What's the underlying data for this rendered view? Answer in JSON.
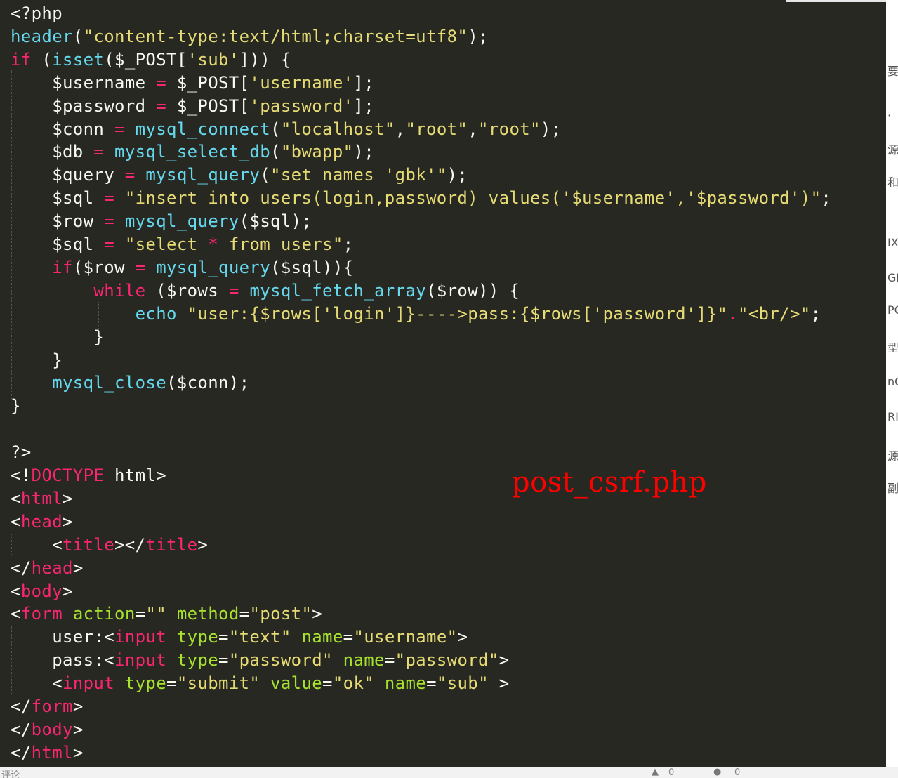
{
  "colors": {
    "background": "#272822",
    "default": "#F8F8F2",
    "keyword": "#F92672",
    "function": "#66D9EF",
    "string": "#E6DB74",
    "attribute": "#A6E22E",
    "annotation": "#FF0000"
  },
  "code_lines": [
    [
      [
        "<?php",
        "d"
      ]
    ],
    [
      [
        "header",
        "f"
      ],
      [
        "(",
        "d"
      ],
      [
        "\"content-type:text/html;charset=utf8\"",
        "s"
      ],
      [
        ");",
        "d"
      ]
    ],
    [
      [
        "if",
        "k"
      ],
      [
        " (",
        "d"
      ],
      [
        "isset",
        "f"
      ],
      [
        "($_POST[",
        "d"
      ],
      [
        "'sub'",
        "s"
      ],
      [
        "])) {",
        "d"
      ]
    ],
    [
      [
        "    $username ",
        "d"
      ],
      [
        "=",
        "k"
      ],
      [
        " $_POST[",
        "d"
      ],
      [
        "'username'",
        "s"
      ],
      [
        "];",
        "d"
      ]
    ],
    [
      [
        "    $password ",
        "d"
      ],
      [
        "=",
        "k"
      ],
      [
        " $_POST[",
        "d"
      ],
      [
        "'password'",
        "s"
      ],
      [
        "];",
        "d"
      ]
    ],
    [
      [
        "    $conn ",
        "d"
      ],
      [
        "=",
        "k"
      ],
      [
        " ",
        "d"
      ],
      [
        "mysql_connect",
        "f"
      ],
      [
        "(",
        "d"
      ],
      [
        "\"localhost\"",
        "s"
      ],
      [
        ",",
        "d"
      ],
      [
        "\"root\"",
        "s"
      ],
      [
        ",",
        "d"
      ],
      [
        "\"root\"",
        "s"
      ],
      [
        ");",
        "d"
      ]
    ],
    [
      [
        "    $db ",
        "d"
      ],
      [
        "=",
        "k"
      ],
      [
        " ",
        "d"
      ],
      [
        "mysql_select_db",
        "f"
      ],
      [
        "(",
        "d"
      ],
      [
        "\"bwapp\"",
        "s"
      ],
      [
        ");",
        "d"
      ]
    ],
    [
      [
        "    $query ",
        "d"
      ],
      [
        "=",
        "k"
      ],
      [
        " ",
        "d"
      ],
      [
        "mysql_query",
        "f"
      ],
      [
        "(",
        "d"
      ],
      [
        "\"set names 'gbk'\"",
        "s"
      ],
      [
        ");",
        "d"
      ]
    ],
    [
      [
        "    $sql ",
        "d"
      ],
      [
        "=",
        "k"
      ],
      [
        " ",
        "d"
      ],
      [
        "\"insert into users(login,password) values('$username','$password')\"",
        "s"
      ],
      [
        ";",
        "d"
      ]
    ],
    [
      [
        "    $row ",
        "d"
      ],
      [
        "=",
        "k"
      ],
      [
        " ",
        "d"
      ],
      [
        "mysql_query",
        "f"
      ],
      [
        "($sql);",
        "d"
      ]
    ],
    [
      [
        "    $sql ",
        "d"
      ],
      [
        "=",
        "k"
      ],
      [
        " ",
        "d"
      ],
      [
        "\"select ",
        "s"
      ],
      [
        "*",
        "k"
      ],
      [
        " from users\"",
        "s"
      ],
      [
        ";",
        "d"
      ]
    ],
    [
      [
        "    ",
        "d"
      ],
      [
        "if",
        "k"
      ],
      [
        "($row ",
        "d"
      ],
      [
        "=",
        "k"
      ],
      [
        " ",
        "d"
      ],
      [
        "mysql_query",
        "f"
      ],
      [
        "($sql)){",
        "d"
      ]
    ],
    [
      [
        "        ",
        "d"
      ],
      [
        "while",
        "k"
      ],
      [
        " ($rows ",
        "d"
      ],
      [
        "=",
        "k"
      ],
      [
        " ",
        "d"
      ],
      [
        "mysql_fetch_array",
        "f"
      ],
      [
        "($row)) {",
        "d"
      ]
    ],
    [
      [
        "            ",
        "d"
      ],
      [
        "echo",
        "f"
      ],
      [
        " ",
        "d"
      ],
      [
        "\"user:{$rows['login']}---->pass:{$rows['password']}\"",
        "s"
      ],
      [
        ".",
        "k"
      ],
      [
        "\"<br/>\"",
        "s"
      ],
      [
        ";",
        "d"
      ]
    ],
    [
      [
        "        }",
        "d"
      ]
    ],
    [
      [
        "    }",
        "d"
      ]
    ],
    [
      [
        "    ",
        "d"
      ],
      [
        "mysql_close",
        "f"
      ],
      [
        "($conn);",
        "d"
      ]
    ],
    [
      [
        "}",
        "d"
      ]
    ],
    [
      [
        "",
        "d"
      ]
    ],
    [
      [
        "?>",
        "d"
      ]
    ],
    [
      [
        "<!",
        "d"
      ],
      [
        "DOCTYPE",
        "k"
      ],
      [
        " html>",
        "d"
      ]
    ],
    [
      [
        "<",
        "d"
      ],
      [
        "html",
        "k"
      ],
      [
        ">",
        "d"
      ]
    ],
    [
      [
        "<",
        "d"
      ],
      [
        "head",
        "k"
      ],
      [
        ">",
        "d"
      ]
    ],
    [
      [
        "    <",
        "d"
      ],
      [
        "title",
        "k"
      ],
      [
        "></",
        "d"
      ],
      [
        "title",
        "k"
      ],
      [
        ">",
        "d"
      ]
    ],
    [
      [
        "</",
        "d"
      ],
      [
        "head",
        "k"
      ],
      [
        ">",
        "d"
      ]
    ],
    [
      [
        "<",
        "d"
      ],
      [
        "body",
        "k"
      ],
      [
        ">",
        "d"
      ]
    ],
    [
      [
        "<",
        "d"
      ],
      [
        "form",
        "k"
      ],
      [
        " ",
        "d"
      ],
      [
        "action",
        "a"
      ],
      [
        "=",
        "d"
      ],
      [
        "\"\"",
        "s"
      ],
      [
        " ",
        "d"
      ],
      [
        "method",
        "a"
      ],
      [
        "=",
        "d"
      ],
      [
        "\"post\"",
        "s"
      ],
      [
        ">",
        "d"
      ]
    ],
    [
      [
        "    user:<",
        "d"
      ],
      [
        "input",
        "k"
      ],
      [
        " ",
        "d"
      ],
      [
        "type",
        "a"
      ],
      [
        "=",
        "d"
      ],
      [
        "\"text\"",
        "s"
      ],
      [
        " ",
        "d"
      ],
      [
        "name",
        "a"
      ],
      [
        "=",
        "d"
      ],
      [
        "\"username\"",
        "s"
      ],
      [
        ">",
        "d"
      ]
    ],
    [
      [
        "    pass:<",
        "d"
      ],
      [
        "input",
        "k"
      ],
      [
        " ",
        "d"
      ],
      [
        "type",
        "a"
      ],
      [
        "=",
        "d"
      ],
      [
        "\"password\"",
        "s"
      ],
      [
        " ",
        "d"
      ],
      [
        "name",
        "a"
      ],
      [
        "=",
        "d"
      ],
      [
        "\"password\"",
        "s"
      ],
      [
        ">",
        "d"
      ]
    ],
    [
      [
        "    <",
        "d"
      ],
      [
        "input",
        "k"
      ],
      [
        " ",
        "d"
      ],
      [
        "type",
        "a"
      ],
      [
        "=",
        "d"
      ],
      [
        "\"submit\"",
        "s"
      ],
      [
        " ",
        "d"
      ],
      [
        "value",
        "a"
      ],
      [
        "=",
        "d"
      ],
      [
        "\"ok\"",
        "s"
      ],
      [
        " ",
        "d"
      ],
      [
        "name",
        "a"
      ],
      [
        "=",
        "d"
      ],
      [
        "\"sub\"",
        "s"
      ],
      [
        " >",
        "d"
      ]
    ],
    [
      [
        "</",
        "d"
      ],
      [
        "form",
        "k"
      ],
      [
        ">",
        "d"
      ]
    ],
    [
      [
        "</",
        "d"
      ],
      [
        "body",
        "k"
      ],
      [
        ">",
        "d"
      ]
    ],
    [
      [
        "</",
        "d"
      ],
      [
        "html",
        "k"
      ],
      [
        ">",
        "d"
      ]
    ]
  ],
  "annotation": "post_csrf.php",
  "right_strip_fragments": [
    "要",
    "·",
    "源",
    "和",
    "IX",
    "GE",
    "PO",
    "型",
    "nC",
    "RI",
    "源",
    "副"
  ],
  "bottom_bar": {
    "left_text": "评论",
    "like_count": "0",
    "comment_count": "0"
  }
}
